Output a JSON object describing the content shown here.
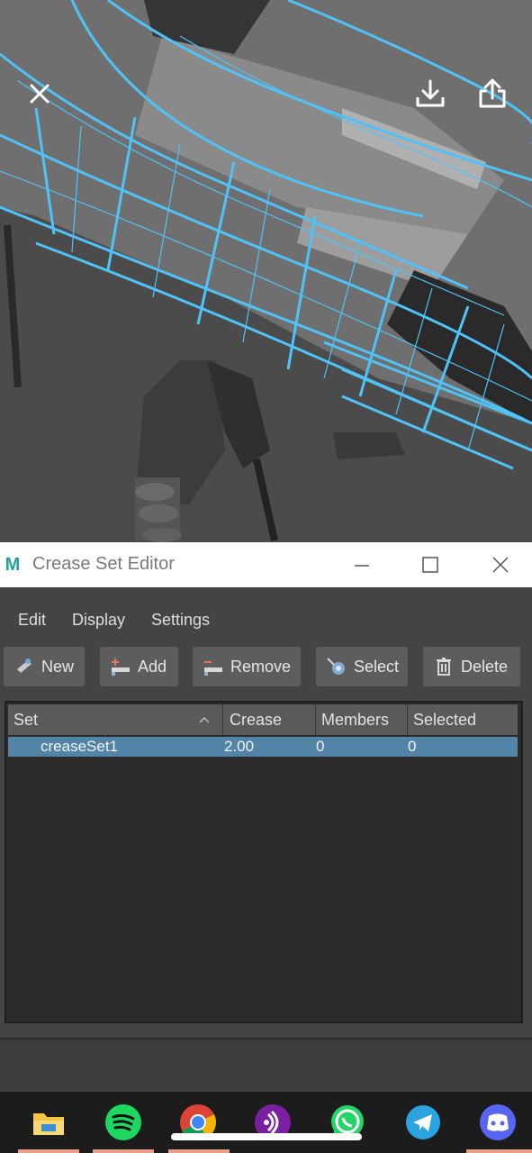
{
  "viewport_overlay": {
    "close_icon": "close-icon",
    "download_icon": "download-icon",
    "share_icon": "share-icon"
  },
  "window": {
    "title": "Crease Set Editor",
    "logo_letter": "M",
    "controls": [
      "minimize-icon",
      "maximize-icon",
      "close-icon"
    ]
  },
  "menu": {
    "items": [
      "Edit",
      "Display",
      "Settings"
    ]
  },
  "toolbar": {
    "new_label": "New",
    "add_label": "Add",
    "remove_label": "Remove",
    "select_label": "Select",
    "delete_label": "Delete"
  },
  "table": {
    "columns": [
      "Set",
      "Crease",
      "Members",
      "Selected"
    ],
    "rows": [
      {
        "set": "creaseSet1",
        "crease": "2.00",
        "members": "0",
        "selected": "0"
      }
    ]
  },
  "taskbar": {
    "apps": [
      "file-explorer-icon",
      "spotify-icon",
      "chrome-icon",
      "podcast-icon",
      "whatsapp-icon",
      "telegram-icon",
      "discord-icon"
    ]
  },
  "colors": {
    "wireframe": "#4fc3f7",
    "selection": "#5284a7",
    "accent_underline": "#e8a08a"
  }
}
